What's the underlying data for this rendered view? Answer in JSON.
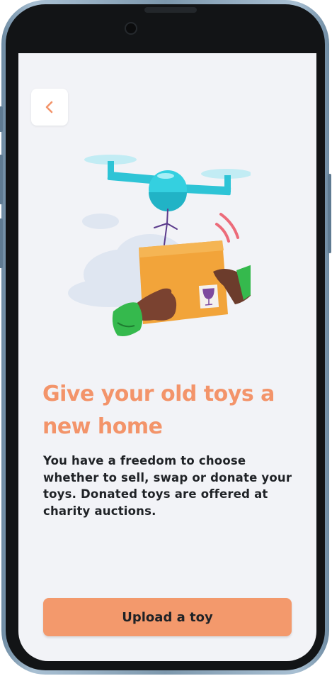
{
  "header": {
    "back_icon": "chevron-left-icon"
  },
  "illustration": {
    "subject": "drone-delivery-box"
  },
  "content": {
    "headline": "Give your old toys a new home",
    "description": "You have a freedom to choose whether to sell, swap or donate your toys. Donated toys are offered at charity auctions."
  },
  "actions": {
    "upload_label": "Upload a toy"
  },
  "colors": {
    "accent": "#f3946a",
    "button": "#f3996c",
    "background": "#f2f3f7",
    "text": "#1f2226"
  }
}
